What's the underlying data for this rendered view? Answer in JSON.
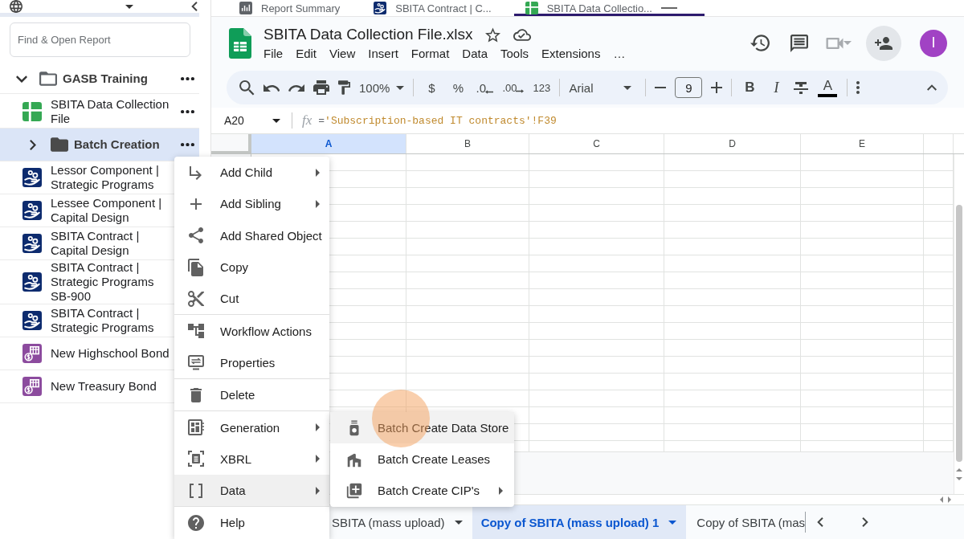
{
  "sidebar": {
    "search": {
      "placeholder": "Find & Open Report"
    },
    "tree": [
      {
        "label": "GASB Training",
        "kind": "folder",
        "expanded": true,
        "selected": false,
        "more_button": true,
        "children": [
          {
            "label": "SBITA Data Collection File",
            "kind": "sheet",
            "selected": false,
            "more_button": true
          },
          {
            "label": "Batch Creation",
            "kind": "folder",
            "expanded": false,
            "selected": true,
            "more_button": true
          },
          {
            "label": "Lessor Component | Strategic Programs",
            "kind": "component",
            "selected": false
          },
          {
            "label": "Lessee Component | Capital Design",
            "kind": "component",
            "selected": false
          },
          {
            "label": "SBITA Contract | Capital Design",
            "kind": "component",
            "selected": false
          },
          {
            "label": "SBITA Contract | Strategic Programs SB-900",
            "kind": "component",
            "selected": false
          },
          {
            "label": "SBITA Contract | Strategic Programs",
            "kind": "component",
            "selected": false
          },
          {
            "label": "New Highschool Bond",
            "kind": "bond",
            "selected": false
          },
          {
            "label": "New Treasury Bond",
            "kind": "bond",
            "selected": false
          }
        ]
      }
    ]
  },
  "tabs": [
    {
      "label": "Report Summary",
      "kind": "report",
      "selected": false
    },
    {
      "label": "SBITA Contract | C...",
      "kind": "component",
      "selected": false
    },
    {
      "label": "SBITA Data Collectio...",
      "kind": "sheet",
      "selected": true
    }
  ],
  "spreadsheet": {
    "title": "SBITA Data Collection File.xlsx",
    "starred": false,
    "menu": [
      "File",
      "Edit",
      "View",
      "Insert",
      "Format",
      "Data",
      "Tools",
      "Extensions",
      "…"
    ],
    "account_initial": "I",
    "toolbar": {
      "zoom": "100%",
      "number_formats": [
        {
          "text": "$",
          "kind": "plain"
        },
        {
          "text": "%",
          "kind": "plain"
        },
        {
          "text": ".0",
          "kind": "decrease"
        },
        {
          "text": ".00",
          "kind": "increase"
        },
        {
          "text": "123",
          "kind": "plain"
        }
      ],
      "font": "Arial",
      "font_size": "9",
      "text_styles": [
        {
          "text": "B",
          "kind": "bold"
        },
        {
          "text": "I",
          "kind": "italic"
        }
      ],
      "text_color": "A"
    },
    "name_box": "A20",
    "function_label": "fx",
    "formula": [
      {
        "kind": "operator",
        "text": "="
      },
      {
        "kind": "reference",
        "text": "'Subscription-based IT contracts'!F39"
      }
    ],
    "columns": [
      {
        "label": "A",
        "selected": true
      },
      {
        "label": "B",
        "selected": false
      },
      {
        "label": "C",
        "selected": false
      },
      {
        "label": "D",
        "selected": false
      },
      {
        "label": "E",
        "selected": false
      }
    ],
    "sheet_tabs": [
      {
        "label": "SBITA (mass upload)",
        "selected": false,
        "dropdown": true
      },
      {
        "label": "Copy of SBITA (mass upload) 1",
        "selected": true,
        "dropdown": true
      },
      {
        "label": "Copy of SBITA (mas",
        "selected": false,
        "dropdown": false
      }
    ]
  },
  "context_menu": {
    "groups": [
      [
        {
          "label": "Add Child",
          "has_submenu": true,
          "selected": false
        },
        {
          "label": "Add Sibling",
          "has_submenu": true,
          "selected": false
        },
        {
          "label": "Add Shared Object",
          "has_submenu": false,
          "selected": false
        },
        {
          "label": "Copy",
          "has_submenu": false,
          "selected": false
        },
        {
          "label": "Cut",
          "has_submenu": false,
          "selected": false
        }
      ],
      [
        {
          "label": "Workflow Actions",
          "has_submenu": false,
          "selected": false
        },
        {
          "label": "Properties",
          "has_submenu": false,
          "selected": false
        }
      ],
      [
        {
          "label": "Delete",
          "has_submenu": false,
          "selected": false
        }
      ],
      [
        {
          "label": "Generation",
          "has_submenu": true,
          "selected": false
        },
        {
          "label": "XBRL",
          "has_submenu": true,
          "selected": false
        },
        {
          "label": "Data",
          "has_submenu": true,
          "selected": true
        }
      ],
      [
        {
          "label": "Help",
          "has_submenu": false,
          "selected": false
        }
      ]
    ],
    "submenu": {
      "items": [
        {
          "label": "Batch Create Data Store",
          "has_submenu": false,
          "selected": true
        },
        {
          "label": "Batch Create Leases",
          "has_submenu": false,
          "selected": false
        },
        {
          "label": "Batch Create CIP's",
          "has_submenu": true,
          "selected": false
        }
      ]
    }
  }
}
